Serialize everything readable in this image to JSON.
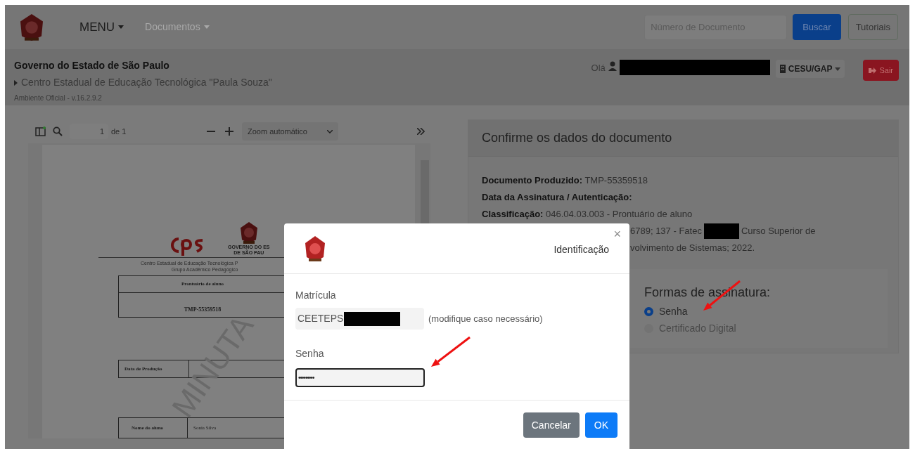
{
  "navbar": {
    "menu": "MENU",
    "documents_menu": "Documentos",
    "search": {
      "placeholder": "Número de Documento"
    },
    "buttons": [
      {
        "label": "Buscar",
        "kind": "primary"
      },
      {
        "label": "Tutoriais",
        "kind": "outline"
      }
    ]
  },
  "header": {
    "title": "Governo do Estado de São Paulo",
    "organization": "Centro Estadual de Educação Tecnológica \"Paula Souza\"",
    "environment": "Ambiente Oficial - v.16.2.9.2",
    "greeting": "Olá",
    "unit": "CESU/GAP",
    "logout": "Sair"
  },
  "pdf_viewer": {
    "page_input": "1",
    "page_count": "de 1",
    "zoom": "Zoom automático",
    "document": {
      "seal_text": [
        "GOVERNO DO ES",
        "DE SÃO PAU"
      ],
      "institution": [
        "Centro Estadual de Educação Tecnológica P",
        "Grupo Acadêmico Pedagógico"
      ],
      "doc_title": "Prontuário de aluno",
      "doc_number": "TMP-55359518",
      "watermark": "MINUTA",
      "production_label": "Data de Produção",
      "student_label": "Nome do aluno",
      "student_value": "Sonia Silva"
    }
  },
  "details": {
    "title": "Confirme os dados do documento",
    "fields": [
      {
        "label": "Documento Produzido:",
        "value": "TMP-55359518"
      },
      {
        "label": "Data da Assinatura / Autenticação:"
      },
      {
        "label": "Classificação:",
        "value": "046.04.03.003 - Prontuário de aluno"
      }
    ],
    "continuation": {
      "line_1_start": "6789; 137 - Fatec",
      "line_1_end": "Curso Superior de",
      "line_2": "volvimento de Sistemas; 2022."
    },
    "signature_methods": {
      "title": "Formas de assinatura:",
      "options": [
        {
          "label": "Senha",
          "selected": true,
          "disabled": false
        },
        {
          "label": "Certificado Digital",
          "selected": false,
          "disabled": true
        }
      ]
    }
  },
  "modal": {
    "title": "Identificação",
    "close": "×",
    "registration": {
      "label": "Matrícula",
      "value": "CEETEPS",
      "hint": "(modifique caso necessário)"
    },
    "password": {
      "label": "Senha",
      "value": "•••••••••",
      "focused": true
    },
    "buttons": [
      {
        "label": "Cancelar",
        "kind": "secondary"
      },
      {
        "label": "OK",
        "kind": "primary"
      }
    ]
  }
}
